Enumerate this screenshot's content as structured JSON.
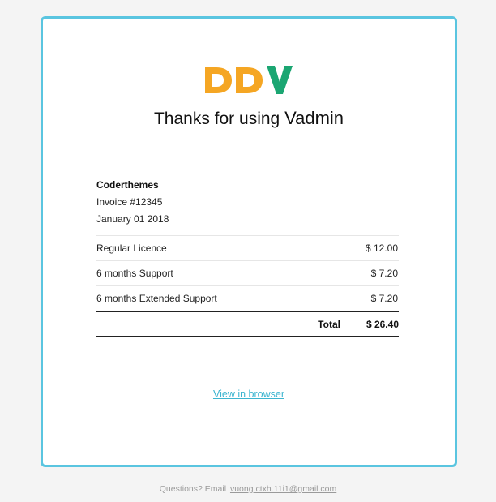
{
  "logo": {
    "text": "DDV",
    "colors": {
      "d": "#f5a623",
      "v": "#1ba672"
    }
  },
  "header": {
    "thanks_text": "Thanks for using",
    "brand_name": "Vadmin"
  },
  "invoice": {
    "company": "Coderthemes",
    "number": "Invoice #12345",
    "date": "January 01 2018",
    "items": [
      {
        "description": "Regular Licence",
        "price": "$ 12.00"
      },
      {
        "description": "6 months Support",
        "price": "$ 7.20"
      },
      {
        "description": "6 months Extended Support",
        "price": "$ 7.20"
      }
    ],
    "total_label": "Total",
    "total_value": "$ 26.40"
  },
  "links": {
    "view_in_browser": "View in browser"
  },
  "footer": {
    "questions_text": "Questions? Email",
    "email": "vuong.ctxh.11i1@gmail.com"
  },
  "theme": {
    "card_border": "#5ac5e0",
    "link": "#3db5d0"
  }
}
